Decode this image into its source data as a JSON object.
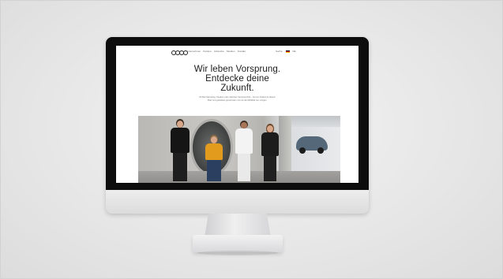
{
  "website": {
    "nav_items": [
      "Unternehmen",
      "Karriere",
      "Jobsuche",
      "Studium",
      "Kontakt"
    ],
    "utility": {
      "search": "Suche",
      "language": "DE"
    },
    "headline": {
      "line1": "Wir leben Vorsprung.",
      "line2": "Entdecke deine",
      "line3": "Zukunft."
    },
    "intro_text": "Ob Berufseinstieg, Studium oder nächster Karriereschritt – bei uns findest du deinen Platz und gestaltest gemeinsam mit uns die Mobilität von morgen."
  },
  "colors": {
    "screen_bezel": "#0d0d0d",
    "page_background": "#ffffff",
    "headline_text": "#1b1b1b",
    "backdrop": "#e6e6e6"
  }
}
